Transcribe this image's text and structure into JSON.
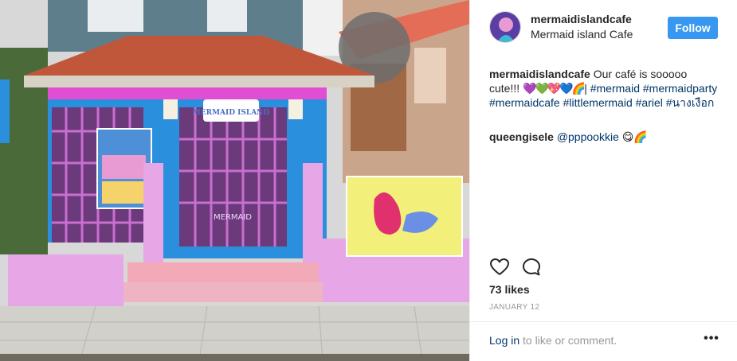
{
  "post": {
    "username": "mermaidislandcafe",
    "location": "Mermaid island Cafe",
    "follow_label": "Follow",
    "caption_text": "Our café is sooooo cute!!!",
    "caption_emoji": "💜💚💖💙🌈",
    "caption_tags": [
      "#mermaid",
      "#mermaidparty",
      "#mermaidcafe",
      "#littlemermaid",
      "#ariel",
      "#นางเงือก"
    ],
    "comment": {
      "username": "queengisele",
      "mention": "@pppookkie",
      "emoji": "😋🌈"
    },
    "likes": "73 likes",
    "date": "JANUARY 12",
    "login_link": "Log in",
    "login_suffix": "to like or comment.",
    "more_label": "•••"
  },
  "photo": {
    "sign_text": "MERMAID ISLAND",
    "door_text": "MERMAID"
  },
  "icons": {
    "like": "heart-outline-icon",
    "comment": "speech-bubble-icon",
    "more": "ellipsis-icon"
  },
  "colors": {
    "follow_bg": "#3897f0",
    "tag": "#003569",
    "muted": "#999999",
    "roof": "#c0573b",
    "wall_blue": "#2a8fdc",
    "wall_pink": "#e7a6e6",
    "poster_yellow": "#f2f07a"
  }
}
